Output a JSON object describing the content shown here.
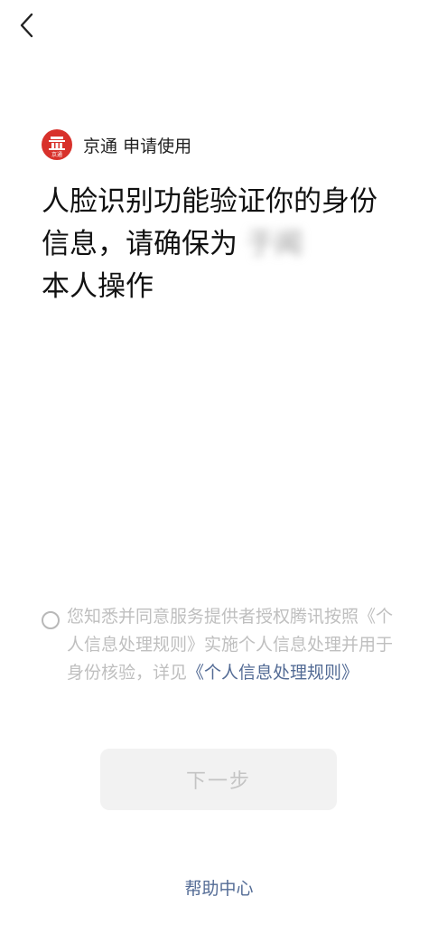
{
  "nav": {
    "back_icon": "chevron-left-icon"
  },
  "app": {
    "logo_icon": "jingtong-logo-icon",
    "logo_text": "京通",
    "name": "京通",
    "request_text": "申请使用",
    "brand_color": "#d8312b"
  },
  "headline": {
    "text": "人脸识别功能验证你的身份信息，请确保为",
    "name_masked": "于闻",
    "suffix": "本人操作"
  },
  "consent": {
    "text_before_link": "您知悉并同意服务提供者授权腾讯按照《个人信息处理规则》实施个人信息处理并用于身份核验，详见",
    "link": "《个人信息处理规则》",
    "checked": false
  },
  "actions": {
    "next_label": "下一步",
    "enabled": false
  },
  "footer": {
    "help_label": "帮助中心"
  },
  "colors": {
    "link": "#536b95",
    "disabled_bg": "#f2f2f2",
    "disabled_text": "#c4c4c4"
  }
}
